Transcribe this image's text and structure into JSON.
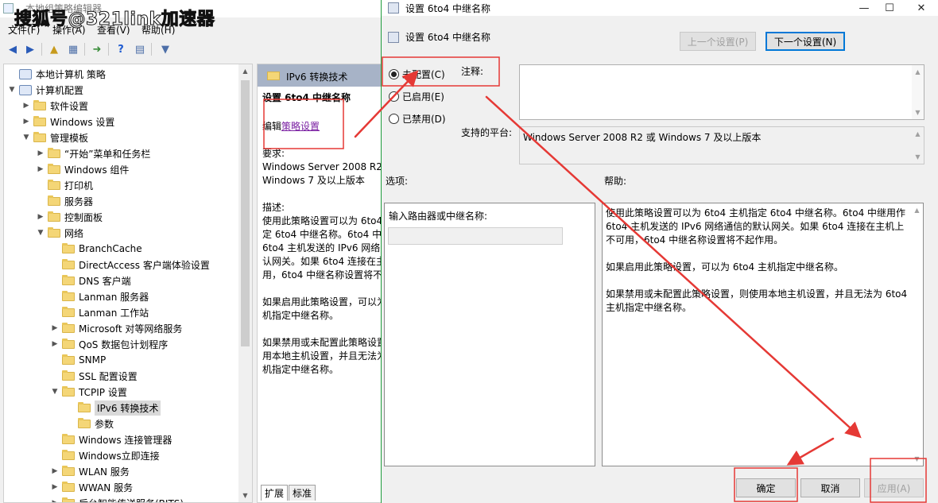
{
  "watermark": "搜狐号@321link加速器",
  "gpedit": {
    "title": "本地组策略编辑器",
    "menus": [
      "文件(F)",
      "操作(A)",
      "查看(V)",
      "帮助(H)"
    ],
    "tree": [
      {
        "label": "本地计算机 策略",
        "level": 0,
        "caret": "",
        "icon": "gear"
      },
      {
        "label": "计算机配置",
        "level": 0,
        "caret": "v",
        "icon": "gear"
      },
      {
        "label": "软件设置",
        "level": 1,
        "caret": ">",
        "icon": "folder"
      },
      {
        "label": "Windows 设置",
        "level": 1,
        "caret": ">",
        "icon": "folder"
      },
      {
        "label": "管理模板",
        "level": 1,
        "caret": "v",
        "icon": "folder"
      },
      {
        "label": "“开始”菜单和任务栏",
        "level": 2,
        "caret": ">",
        "icon": "folder"
      },
      {
        "label": "Windows 组件",
        "level": 2,
        "caret": ">",
        "icon": "folder"
      },
      {
        "label": "打印机",
        "level": 2,
        "caret": "",
        "icon": "folder"
      },
      {
        "label": "服务器",
        "level": 2,
        "caret": "",
        "icon": "folder"
      },
      {
        "label": "控制面板",
        "level": 2,
        "caret": ">",
        "icon": "folder"
      },
      {
        "label": "网络",
        "level": 2,
        "caret": "v",
        "icon": "folder"
      },
      {
        "label": "BranchCache",
        "level": 3,
        "caret": "",
        "icon": "folder"
      },
      {
        "label": "DirectAccess 客户端体验设置",
        "level": 3,
        "caret": "",
        "icon": "folder"
      },
      {
        "label": "DNS 客户端",
        "level": 3,
        "caret": "",
        "icon": "folder"
      },
      {
        "label": "Lanman 服务器",
        "level": 3,
        "caret": "",
        "icon": "folder"
      },
      {
        "label": "Lanman 工作站",
        "level": 3,
        "caret": "",
        "icon": "folder"
      },
      {
        "label": "Microsoft 对等网络服务",
        "level": 3,
        "caret": ">",
        "icon": "folder"
      },
      {
        "label": "QoS 数据包计划程序",
        "level": 3,
        "caret": ">",
        "icon": "folder"
      },
      {
        "label": "SNMP",
        "level": 3,
        "caret": "",
        "icon": "folder"
      },
      {
        "label": "SSL 配置设置",
        "level": 3,
        "caret": "",
        "icon": "folder"
      },
      {
        "label": "TCPIP 设置",
        "level": 3,
        "caret": "v",
        "icon": "folder"
      },
      {
        "label": "IPv6 转换技术",
        "level": 4,
        "caret": "",
        "icon": "folder",
        "selected": true
      },
      {
        "label": "参数",
        "level": 4,
        "caret": "",
        "icon": "folder"
      },
      {
        "label": "Windows 连接管理器",
        "level": 3,
        "caret": "",
        "icon": "folder"
      },
      {
        "label": "Windows立即连接",
        "level": 3,
        "caret": "",
        "icon": "folder"
      },
      {
        "label": "WLAN 服务",
        "level": 3,
        "caret": ">",
        "icon": "folder"
      },
      {
        "label": "WWAN 服务",
        "level": 3,
        "caret": ">",
        "icon": "folder"
      },
      {
        "label": "后台智能传送服务(BITS)",
        "level": 3,
        "caret": ">",
        "icon": "folder"
      }
    ],
    "detail": {
      "header": "IPv6 转换技术",
      "setting_title": "设置 6to4 中继名称",
      "edit_prefix": "编辑",
      "edit_link": "策略设置",
      "requirements": "要求:\nWindows Server 2008 R2\nWindows 7 及以上版本",
      "description": "描述:\n使用此策略设置可以为 6to4\n定 6to4 中继名称。6to4 中\n6to4 主机发送的 IPv6 网络\n认网关。如果 6to4 连接在主\n用，6to4 中继名称设置将不",
      "desc2": "如果启用此策略设置，可以为\n机指定中继名称。",
      "desc3": "如果禁用或未配置此策略设置\n用本地主机设置，并且无法为\n机指定中继名称。",
      "tabs": [
        "扩展",
        "标准"
      ]
    }
  },
  "dialog": {
    "title": "设置 6to4 中继名称",
    "header_title": "设置 6to4 中继名称",
    "prev_button": "上一个设置(P)",
    "next_button": "下一个设置(N)",
    "radios": [
      {
        "label": "未配置(C)",
        "checked": true
      },
      {
        "label": "已启用(E)",
        "checked": false
      },
      {
        "label": "已禁用(D)",
        "checked": false
      }
    ],
    "comment_label": "注释:",
    "platform_label": "支持的平台:",
    "platform_value": "Windows Server 2008 R2 或 Windows 7 及以上版本",
    "options_label": "选项:",
    "help_label": "帮助:",
    "option_field_label": "输入路由器或中继名称:",
    "help_paragraphs": [
      "使用此策略设置可以为 6to4 主机指定 6to4 中继名称。6to4 中继用作 6to4 主机发送的 IPv6 网络通信的默认网关。如果 6to4 连接在主机上不可用，6to4 中继名称设置将不起作用。",
      "如果启用此策略设置，可以为 6to4 主机指定中继名称。",
      "如果禁用或未配置此策略设置，则使用本地主机设置，并且无法为 6to4 主机指定中继名称。"
    ],
    "ok_button": "确定",
    "cancel_button": "取消",
    "apply_button": "应用(A)"
  },
  "colors": {
    "annotation_red": "#e53935",
    "dialog_border": "#1f9c3c",
    "link_purple": "#7a1fa2"
  }
}
